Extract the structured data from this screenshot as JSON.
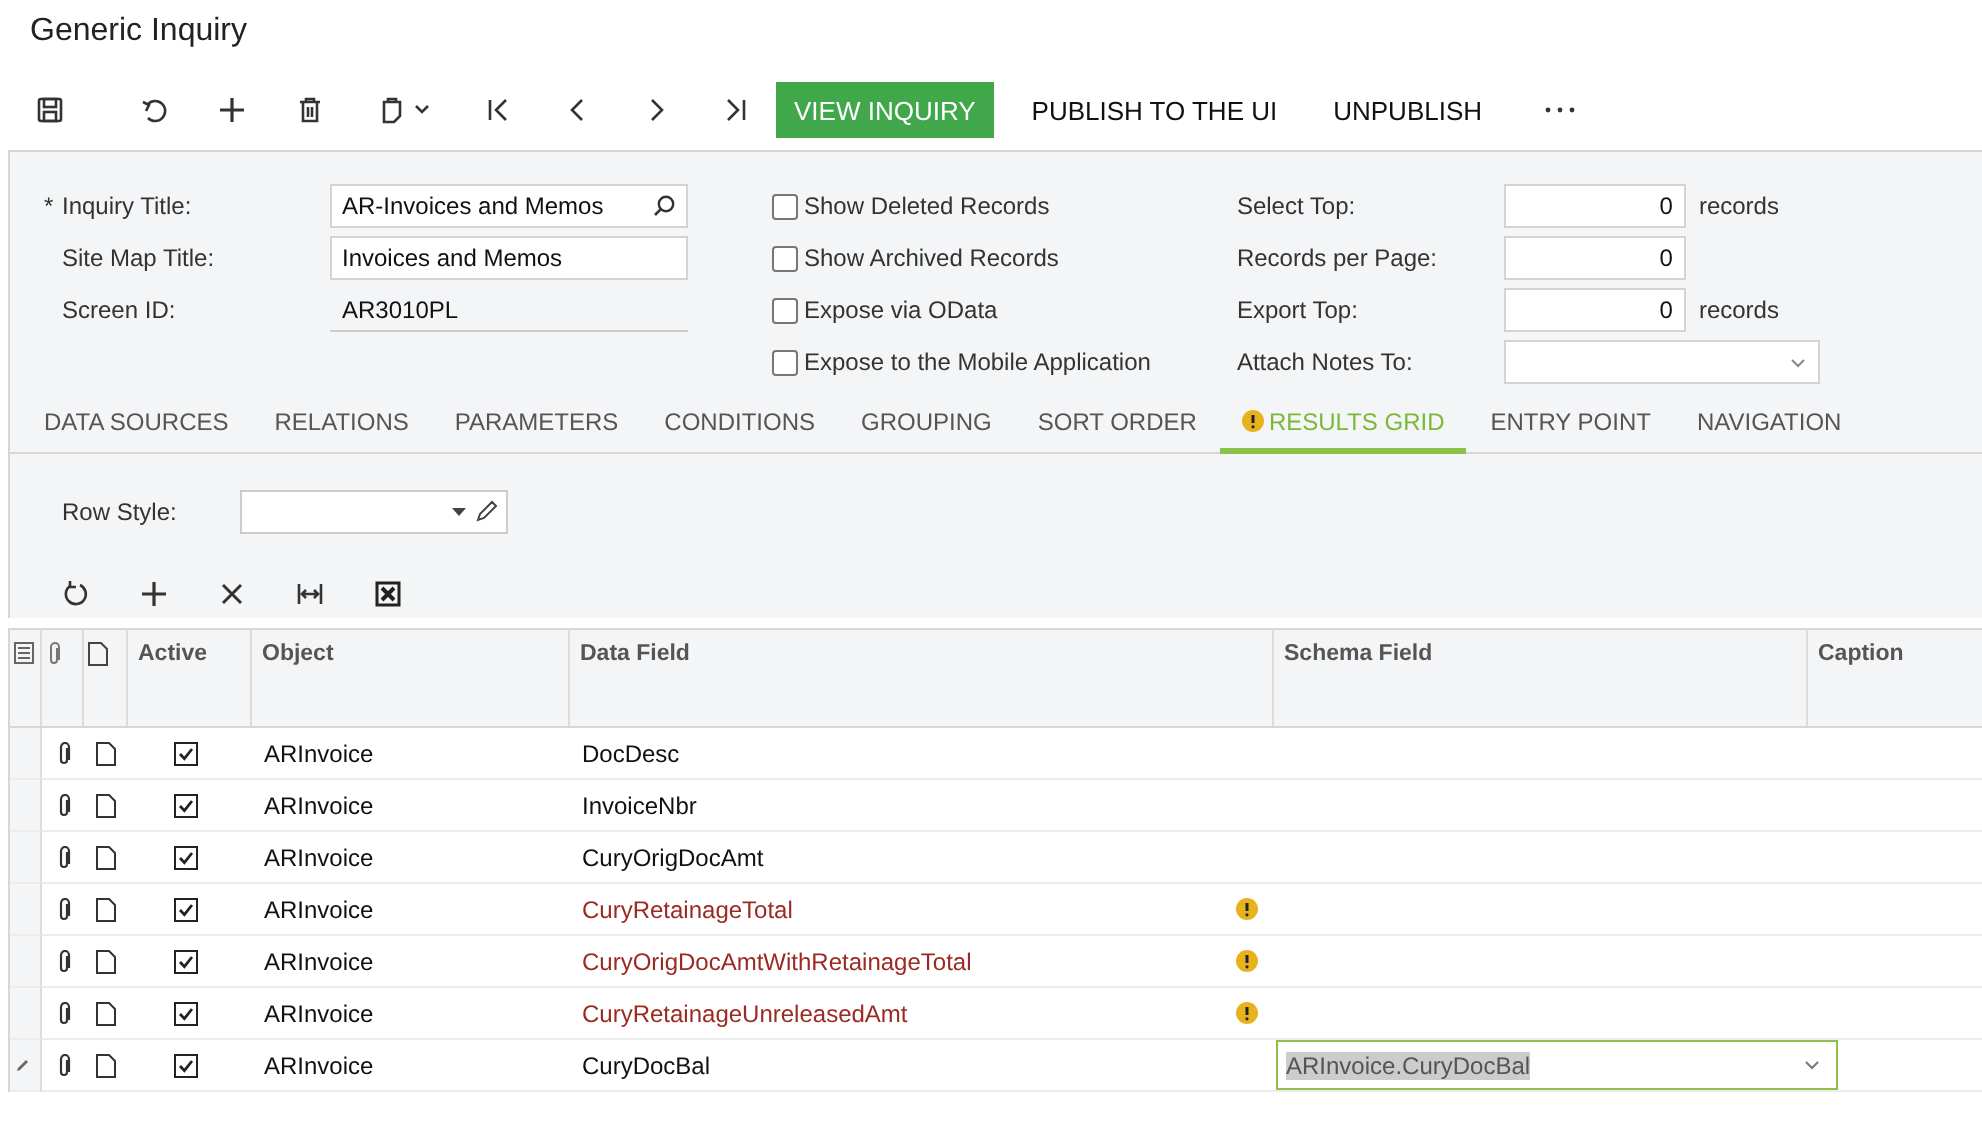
{
  "window": {
    "title": "Generic Inquiry"
  },
  "toolbar": {
    "buttons": [
      {
        "label": "VIEW INQUIRY",
        "primary": true
      },
      {
        "label": "PUBLISH TO THE UI",
        "primary": false
      },
      {
        "label": "UNPUBLISH",
        "primary": false
      }
    ]
  },
  "form": {
    "left_fields": [
      {
        "label": "Inquiry Title:",
        "required_mark": "*",
        "kind": "lookup",
        "value": "AR-Invoices and Memos"
      },
      {
        "label": "Site Map Title:",
        "kind": "text",
        "value": "Invoices and Memos"
      },
      {
        "label": "Screen ID:",
        "kind": "readonly",
        "value": "AR3010PL"
      }
    ],
    "checkboxes": [
      {
        "label": "Show Deleted Records",
        "checked": false
      },
      {
        "label": "Show Archived Records",
        "checked": false
      },
      {
        "label": "Expose via OData",
        "checked": false
      },
      {
        "label": "Expose to the Mobile Application",
        "checked": false
      }
    ],
    "right_fields": [
      {
        "label": "Select Top:",
        "kind": "number",
        "value": "0",
        "suffix": "records"
      },
      {
        "label": "Records per Page:",
        "kind": "number",
        "value": "0"
      },
      {
        "label": "Export Top:",
        "kind": "number",
        "value": "0",
        "suffix": "records"
      },
      {
        "label": "Attach Notes To:",
        "kind": "dropdown"
      }
    ]
  },
  "tabs": [
    {
      "label": "DATA SOURCES",
      "selected": false,
      "warning": false
    },
    {
      "label": "RELATIONS",
      "selected": false,
      "warning": false
    },
    {
      "label": "PARAMETERS",
      "selected": false,
      "warning": false
    },
    {
      "label": "CONDITIONS",
      "selected": false,
      "warning": false
    },
    {
      "label": "GROUPING",
      "selected": false,
      "warning": false
    },
    {
      "label": "SORT ORDER",
      "selected": false,
      "warning": false
    },
    {
      "label": "RESULTS GRID",
      "selected": true,
      "warning": true
    },
    {
      "label": "ENTRY POINT",
      "selected": false,
      "warning": false
    },
    {
      "label": "NAVIGATION",
      "selected": false,
      "warning": false
    }
  ],
  "row_style": {
    "label": "Row Style:"
  },
  "grid": {
    "columns": [
      "Active",
      "Object",
      "Data Field",
      "Schema Field",
      "Caption"
    ],
    "rows": [
      {
        "active": true,
        "object": "ARInvoice",
        "data_field": "DocDesc",
        "warning": false,
        "editing": false
      },
      {
        "active": true,
        "object": "ARInvoice",
        "data_field": "InvoiceNbr",
        "warning": false,
        "editing": false
      },
      {
        "active": true,
        "object": "ARInvoice",
        "data_field": "CuryOrigDocAmt",
        "warning": false,
        "editing": false
      },
      {
        "active": true,
        "object": "ARInvoice",
        "data_field": "CuryRetainageTotal",
        "warning": true,
        "editing": false
      },
      {
        "active": true,
        "object": "ARInvoice",
        "data_field": "CuryOrigDocAmtWithRetainageTotal",
        "warning": true,
        "editing": false
      },
      {
        "active": true,
        "object": "ARInvoice",
        "data_field": "CuryRetainageUnreleasedAmt",
        "warning": true,
        "editing": false
      },
      {
        "active": true,
        "object": "ARInvoice",
        "data_field": "CuryDocBal",
        "warning": false,
        "editing": true,
        "schema_field": "ARInvoice.CuryDocBal"
      }
    ]
  }
}
